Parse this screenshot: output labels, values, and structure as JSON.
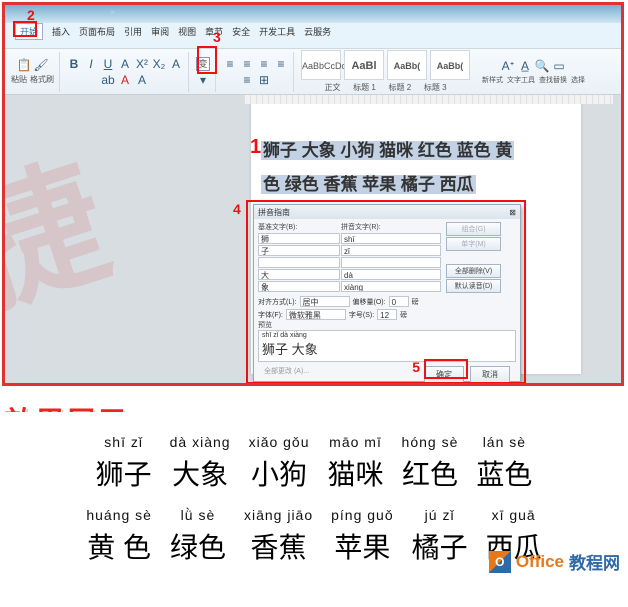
{
  "annotations": {
    "n1": "1",
    "n2": "2",
    "n3": "3",
    "n4": "4",
    "n5": "5"
  },
  "tabs": [
    "开始",
    "插入",
    "页面布局",
    "引用",
    "审阅",
    "视图",
    "章节",
    "安全",
    "开发工具",
    "云服务"
  ],
  "ribbon": {
    "paste": "粘贴",
    "fmtpaint": "格式刷",
    "font_btns": [
      "B",
      "I",
      "U",
      "A",
      "X²",
      "X₂",
      "A",
      "ab",
      "A",
      "A"
    ],
    "para_btns": [
      "≡",
      "≡",
      "≡",
      "≡",
      "≡",
      "⊞"
    ],
    "styles": [
      "AaBbCcDc",
      "AaBl",
      "AaBb(",
      "AaBb("
    ],
    "style_lbls": [
      "正文",
      "标题 1",
      "标题 2",
      "标题 3"
    ],
    "r_btns": [
      "新样式",
      "文字工具",
      "查找替换",
      "选择"
    ]
  },
  "pinyin_btn": "变",
  "doc_line1": "狮子 大象 小狗 猫咪 红色 蓝色 黄",
  "doc_line2": "色 绿色 香蕉 苹果 橘子 西瓜",
  "dialog": {
    "title": "拼音指南",
    "lbl_base": "基准文字(B):",
    "lbl_ruby": "拼音文字(R):",
    "base": [
      "狮",
      "子",
      "",
      "大",
      "象"
    ],
    "ruby": [
      "shī",
      "zǐ",
      "",
      "dà",
      "xiàng"
    ],
    "btn_combine": "组合(G)",
    "btn_single": "单字(M)",
    "btn_allremove": "全部删除(V)",
    "btn_default": "默认读音(D)",
    "lbl_align": "对齐方式(L):",
    "val_align": "居中",
    "lbl_offset": "偏移量(O):",
    "val_offset": "0",
    "unit_pt": "磅",
    "lbl_font": "字体(F):",
    "val_font": "微软雅黑",
    "lbl_size": "字号(S):",
    "val_size": "12",
    "lbl_preview": "预览",
    "prev_pin": "shī zǐ  dà xiàng",
    "prev_han": "狮子 大象",
    "all_pinyin": "全部更改 (A)...",
    "ok": "确定",
    "cancel": "取消"
  },
  "watermark": "捷",
  "result_title": "效果展示：",
  "results": [
    [
      {
        "p": "shī  zǐ",
        "h": "狮子"
      },
      {
        "p": "dà xiàng",
        "h": "大象"
      },
      {
        "p": "xiǎo gǒu",
        "h": "小狗"
      },
      {
        "p": "māo  mī",
        "h": "猫咪"
      },
      {
        "p": "hóng  sè",
        "h": "红色"
      },
      {
        "p": "lán  sè",
        "h": "蓝色"
      }
    ],
    [
      {
        "p": "huáng  sè",
        "h": "黄 色"
      },
      {
        "p": "lǜ  sè",
        "h": "绿色"
      },
      {
        "p": "xiāng jiāo",
        "h": "香蕉"
      },
      {
        "p": "píng guǒ",
        "h": "苹果"
      },
      {
        "p": "jú  zǐ",
        "h": "橘子"
      },
      {
        "p": "xī guā",
        "h": "西瓜"
      }
    ]
  ],
  "credit": {
    "a": "Office",
    "b": "教程网"
  }
}
